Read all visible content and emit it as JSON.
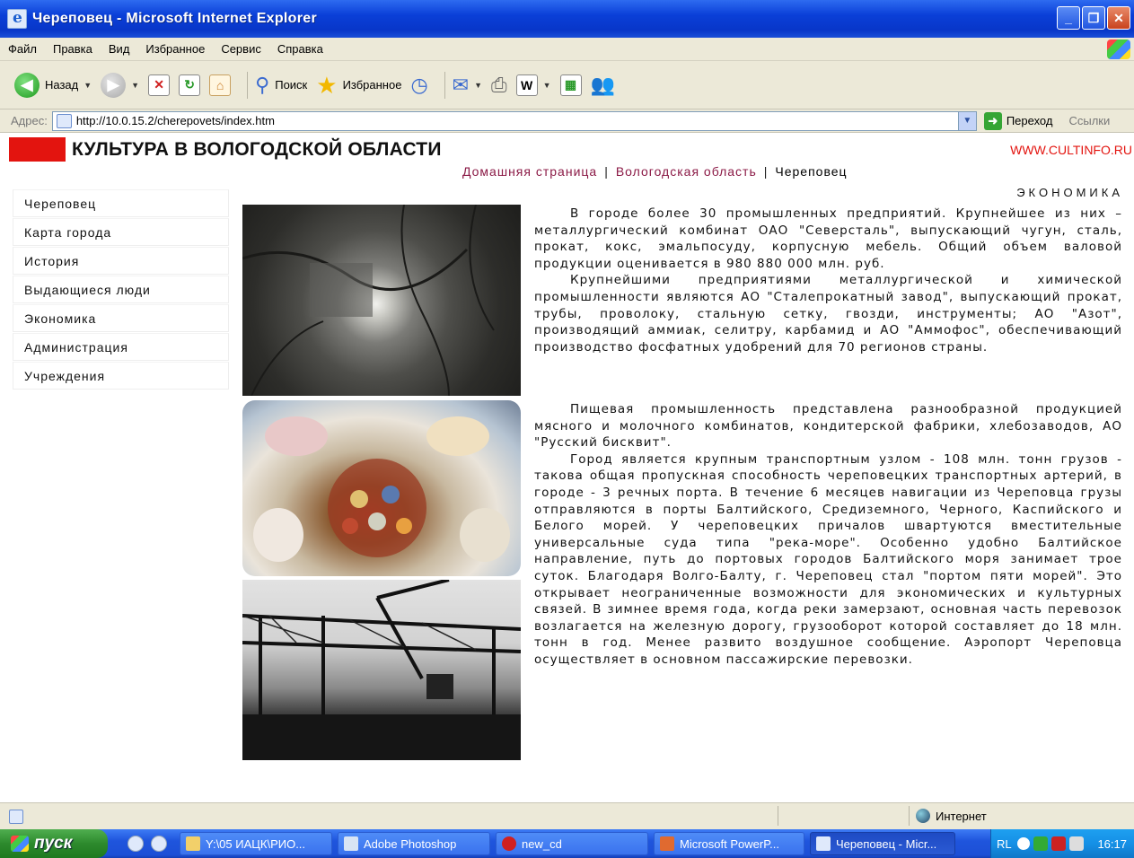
{
  "window": {
    "title": "Череповец - Microsoft Internet Explorer"
  },
  "menu": [
    "Файл",
    "Правка",
    "Вид",
    "Избранное",
    "Сервис",
    "Справка"
  ],
  "toolbar": {
    "back": "Назад",
    "search": "Поиск",
    "favorites": "Избранное"
  },
  "address": {
    "label": "Адрес:",
    "url": "http://10.0.15.2/cherepovets/index.htm",
    "go": "Переход",
    "links": "Ссылки"
  },
  "page": {
    "site_title": "КУЛЬТУРА В ВОЛОГОДСКОЙ ОБЛАСТИ",
    "site_url": "WWW.CULTINFO.RU",
    "breadcrumb": [
      "Домашняя страница",
      "Вологодская область",
      "Череповец"
    ],
    "breadcrumb_sep": "|",
    "nav": [
      "Череповец",
      "Карта города",
      "История",
      "Выдающиеся люди",
      "Экономика",
      "Администрация",
      "Учреждения"
    ],
    "section": "ЭКОНОМИКА",
    "paragraphs_top": [
      "В городе более 30 промышленных предприятий. Крупнейшее из них – металлургический комбинат ОАО \"Северсталь\", выпускающий чугун, сталь, прокат, кокс, эмальпосуду, корпусную мебель. Общий объем валовой продукции оценивается в 980 880 000 млн. руб.",
      "Крупнейшими предприятиями металлургической и химической промышленности являются АО \"Сталепрокатный завод\", выпускающий прокат, трубы, проволоку, стальную сетку, гвозди, инструменты; АО \"Азот\", производящий аммиак, селитру, карбамид и АО \"Аммофос\", обеспечивающий производство фосфатных удобрений для 70 регионов страны."
    ],
    "paragraphs_bottom": [
      "Пищевая промышленность представлена разнообразной продукцией мясного и молочного комбинатов, кондитерской фабрики, хлебозаводов, АО \"Русский бисквит\".",
      "Город является крупным транспортным узлом - 108 млн. тонн грузов - такова общая пропускная способность череповецких транспортных артерий, в городе - 3 речных порта. В течение 6 месяцев навигации из Череповца грузы отправляются в порты Балтийского, Средиземного, Черного, Каспийского и Белого морей. У череповецких причалов швартуются вместительные универсальные суда типа \"река-море\". Особенно удобно Балтийское направление, путь до портовых городов Балтийского моря занимает трое суток. Благодаря Волго-Балту, г. Череповец стал \"портом пяти морей\". Это открывает неограниченные возможности для экономических и культурных связей. В зимнее время года, когда реки замерзают, основная часть перевозок возлагается на железную дорогу, грузооборот которой составляет до 18 млн. тонн в год. Менее развито воздушное сообщение. Аэропорт Череповца осуществляет в основном пассажирские перевозки."
    ]
  },
  "status": {
    "zone": "Интернет"
  },
  "taskbar": {
    "start": "пуск",
    "tasks": [
      "Y:\\05 ИАЦК\\РИО...",
      "Adobe Photoshop",
      "new_cd",
      "Microsoft PowerP...",
      "Череповец - Micr..."
    ],
    "lang": "RL",
    "clock": "16:17"
  },
  "colors": {
    "accent_red": "#e3140f",
    "link": "#8b1a46",
    "xp_blue": "#0a3fd8"
  }
}
